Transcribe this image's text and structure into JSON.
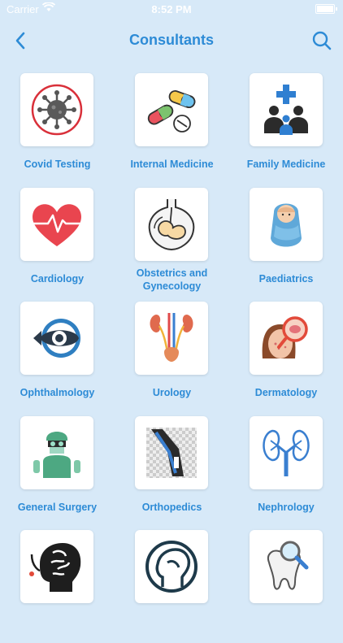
{
  "status": {
    "carrier": "Carrier",
    "time": "8:52 PM"
  },
  "header": {
    "title": "Consultants"
  },
  "icons": {
    "back": "back-chevron-icon",
    "search": "search-icon"
  },
  "consultants": [
    {
      "label": "Covid Testing",
      "icon": "virus-icon"
    },
    {
      "label": "Internal Medicine",
      "icon": "pills-icon"
    },
    {
      "label": "Family Medicine",
      "icon": "family-icon"
    },
    {
      "label": "Cardiology",
      "icon": "heart-icon"
    },
    {
      "label": "Obstetrics and Gynecology",
      "icon": "fetus-icon"
    },
    {
      "label": "Paediatrics",
      "icon": "baby-icon"
    },
    {
      "label": "Ophthalmology",
      "icon": "eye-icon"
    },
    {
      "label": "Urology",
      "icon": "urinary-tract-icon"
    },
    {
      "label": "Dermatology",
      "icon": "skin-magnifier-icon"
    },
    {
      "label": "General Surgery",
      "icon": "surgeon-icon"
    },
    {
      "label": "Orthopedics",
      "icon": "knee-bone-icon"
    },
    {
      "label": "Nephrology",
      "icon": "kidneys-icon"
    },
    {
      "label": "",
      "icon": "brain-stethoscope-icon"
    },
    {
      "label": "",
      "icon": "ent-head-icon"
    },
    {
      "label": "",
      "icon": "tooth-magnifier-icon"
    }
  ],
  "colors": {
    "background": "#d7e9f8",
    "accent": "#2d8bd6"
  }
}
